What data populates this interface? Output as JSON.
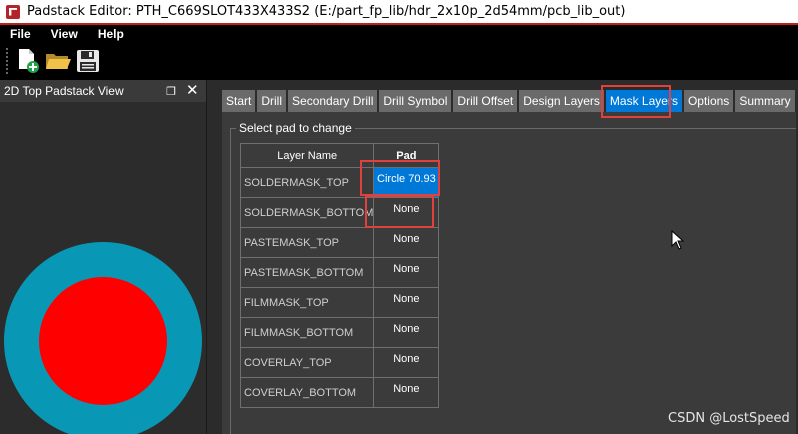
{
  "window": {
    "title": "Padstack Editor: PTH_C669SLOT433X433S2  (E:/part_fp_lib/hdr_2x10p_2d54mm/pcb_lib_out)"
  },
  "menu": [
    "File",
    "View",
    "Help"
  ],
  "toolbar": {
    "buttons": [
      "new-file-icon",
      "open-folder-icon",
      "save-icon"
    ]
  },
  "left_panel": {
    "title": "2D Top Padstack View",
    "restore_glyph": "❐",
    "close_glyph": "✕",
    "colors": {
      "outer": "#0898b5",
      "inner": "#ff0000"
    }
  },
  "tabs": [
    {
      "label": "Start",
      "active": false
    },
    {
      "label": "Drill",
      "active": false
    },
    {
      "label": "Secondary Drill",
      "active": false
    },
    {
      "label": "Drill Symbol",
      "active": false
    },
    {
      "label": "Drill Offset",
      "active": false
    },
    {
      "label": "Design Layers",
      "active": false
    },
    {
      "label": "Mask Layers",
      "active": true
    },
    {
      "label": "Options",
      "active": false
    },
    {
      "label": "Summary",
      "active": false
    }
  ],
  "group_label": "Select pad to change",
  "table": {
    "headers": [
      "Layer Name",
      "Pad"
    ],
    "rows": [
      {
        "layer": "SOLDERMASK_TOP",
        "pad": "Circle 70.93"
      },
      {
        "layer": "SOLDERMASK_BOTTOM",
        "pad": "None"
      },
      {
        "layer": "PASTEMASK_TOP",
        "pad": "None"
      },
      {
        "layer": "PASTEMASK_BOTTOM",
        "pad": "None"
      },
      {
        "layer": "FILMMASK_TOP",
        "pad": "None"
      },
      {
        "layer": "FILMMASK_BOTTOM",
        "pad": "None"
      },
      {
        "layer": "COVERLAY_TOP",
        "pad": "None"
      },
      {
        "layer": "COVERLAY_BOTTOM",
        "pad": "None"
      }
    ]
  },
  "watermark": "CSDN @LostSpeed",
  "colors": {
    "accent_red": "#c21f1f",
    "selection_blue": "#0078d7",
    "highlight_box": "#e0413f"
  }
}
